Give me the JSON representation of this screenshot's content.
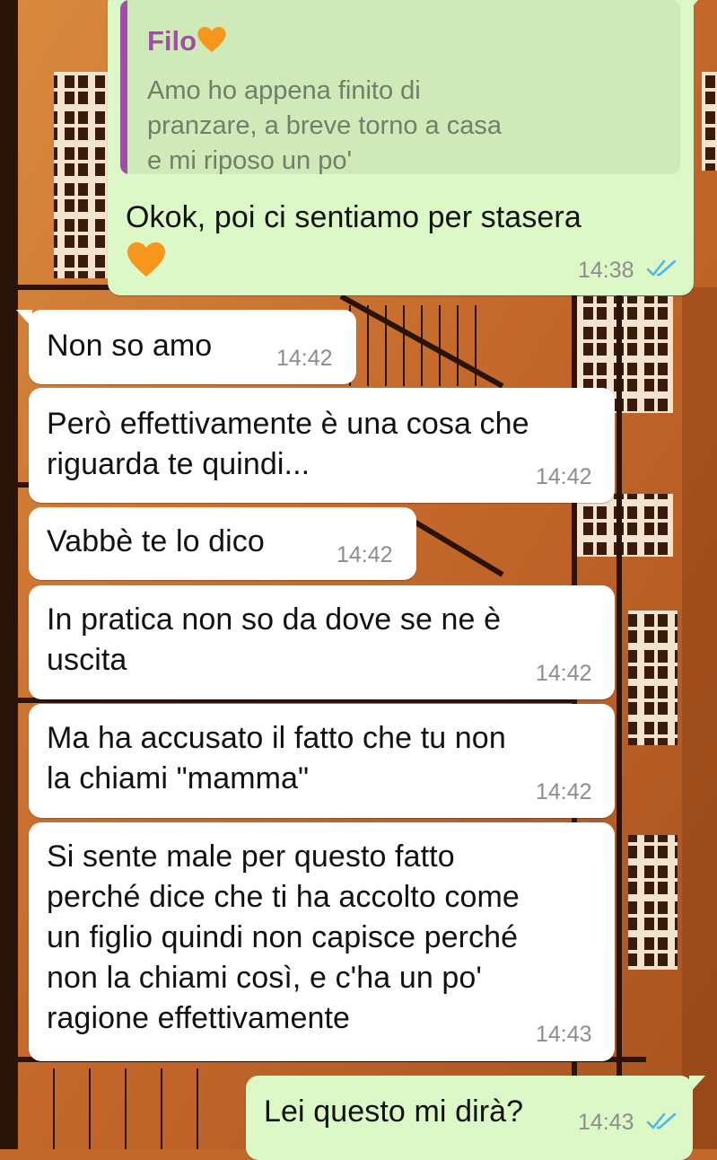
{
  "colors": {
    "incoming_bubble": "#ffffff",
    "outgoing_bubble": "#dcf8c6",
    "read_ticks": "#4fb6ec",
    "quote_author": "#a04fa6",
    "wallpaper": "#c2682a"
  },
  "chat": {
    "quoted_reply": {
      "author": "Filo",
      "author_emoji": "orange-heart-icon",
      "text_lines": [
        "Amo ho appena finito di",
        "pranzare, a breve torno a casa",
        "e mi riposo un po'"
      ]
    },
    "messages": [
      {
        "direction": "outgoing",
        "lines": [
          "Okok, poi ci sentiamo per stasera"
        ],
        "emoji": "orange-heart-icon",
        "time": "14:38",
        "status": "read-double-check-icon"
      },
      {
        "direction": "incoming",
        "lines": [
          "Non so amo"
        ],
        "time": "14:42"
      },
      {
        "direction": "incoming",
        "lines": [
          "Però effettivamente è una cosa che",
          "riguarda te quindi..."
        ],
        "time": "14:42"
      },
      {
        "direction": "incoming",
        "lines": [
          "Vabbè te lo dico"
        ],
        "time": "14:42"
      },
      {
        "direction": "incoming",
        "lines": [
          "In pratica non so da dove se ne è",
          "uscita"
        ],
        "time": "14:42"
      },
      {
        "direction": "incoming",
        "lines": [
          "Ma ha accusato il fatto che tu non",
          "la chiami \"mamma\""
        ],
        "time": "14:42"
      },
      {
        "direction": "incoming",
        "lines": [
          "Si sente male per questo fatto",
          "perché dice che ti ha accolto come",
          "un figlio quindi non capisce perché",
          "non la chiami così, e c'ha un po'",
          "ragione effettivamente"
        ],
        "time": "14:43"
      },
      {
        "direction": "outgoing",
        "lines": [
          "Lei questo mi dirà?"
        ],
        "time": "14:43",
        "status": "read-double-check-icon"
      }
    ]
  }
}
